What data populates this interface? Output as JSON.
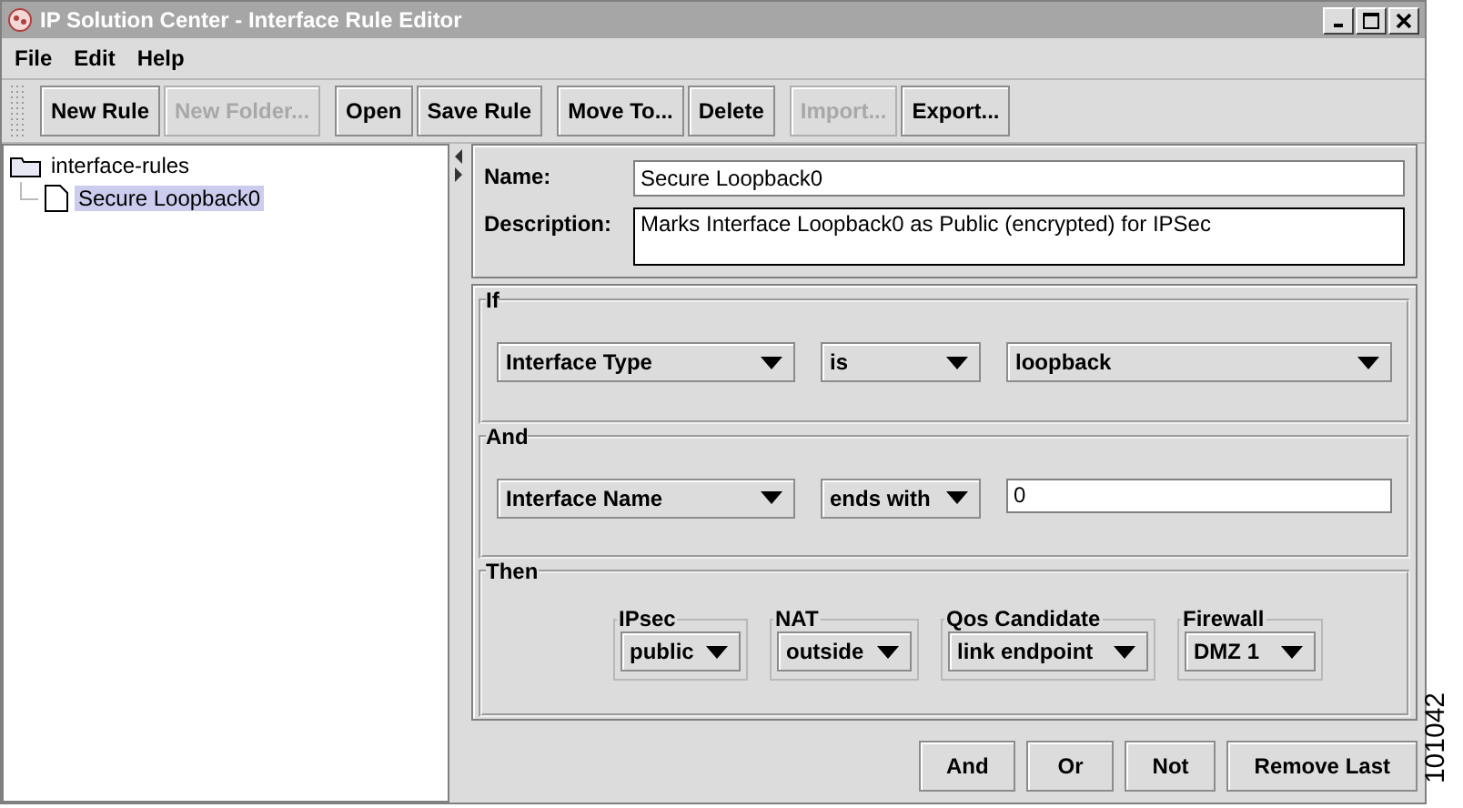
{
  "window": {
    "title": "IP Solution Center - Interface Rule Editor"
  },
  "menu": [
    "File",
    "Edit",
    "Help"
  ],
  "toolbar_groups": [
    [
      {
        "label": "New Rule",
        "disabled": false
      },
      {
        "label": "New Folder...",
        "disabled": true
      }
    ],
    [
      {
        "label": "Open",
        "disabled": false
      },
      {
        "label": "Save Rule",
        "disabled": false
      }
    ],
    [
      {
        "label": "Move To...",
        "disabled": false
      },
      {
        "label": "Delete",
        "disabled": false
      }
    ],
    [
      {
        "label": "Import...",
        "disabled": true
      },
      {
        "label": "Export...",
        "disabled": false
      }
    ]
  ],
  "tree": [
    {
      "label": "interface-rules",
      "kind": "folder",
      "selected": false,
      "children": [
        {
          "label": "Secure Loopback0",
          "kind": "rule",
          "selected": true
        }
      ]
    }
  ],
  "name": {
    "label": "Name:",
    "value": "Secure Loopback0"
  },
  "description": {
    "label": "Description:",
    "value": "Marks Interface Loopback0 as Public (encrypted) for IPSec"
  },
  "conditions": [
    {
      "title": "If",
      "fields": [
        {
          "kind": "dropdown",
          "value": "Interface Type"
        },
        {
          "kind": "dropdown",
          "value": "is"
        },
        {
          "kind": "dropdown",
          "value": "loopback"
        }
      ]
    },
    {
      "title": "And",
      "fields": [
        {
          "kind": "dropdown",
          "value": "Interface Name"
        },
        {
          "kind": "dropdown",
          "value": "ends with"
        },
        {
          "kind": "text",
          "value": "0"
        }
      ]
    }
  ],
  "then": {
    "title": "Then",
    "groups": [
      {
        "label": "IPsec",
        "value": "public"
      },
      {
        "label": "NAT",
        "value": "outside"
      },
      {
        "label": "Qos Candidate",
        "value": "link endpoint"
      },
      {
        "label": "Firewall",
        "value": "DMZ 1"
      }
    ]
  },
  "buttons": [
    "And",
    "Or",
    "Not",
    "Remove Last"
  ],
  "figure_number": "101042"
}
